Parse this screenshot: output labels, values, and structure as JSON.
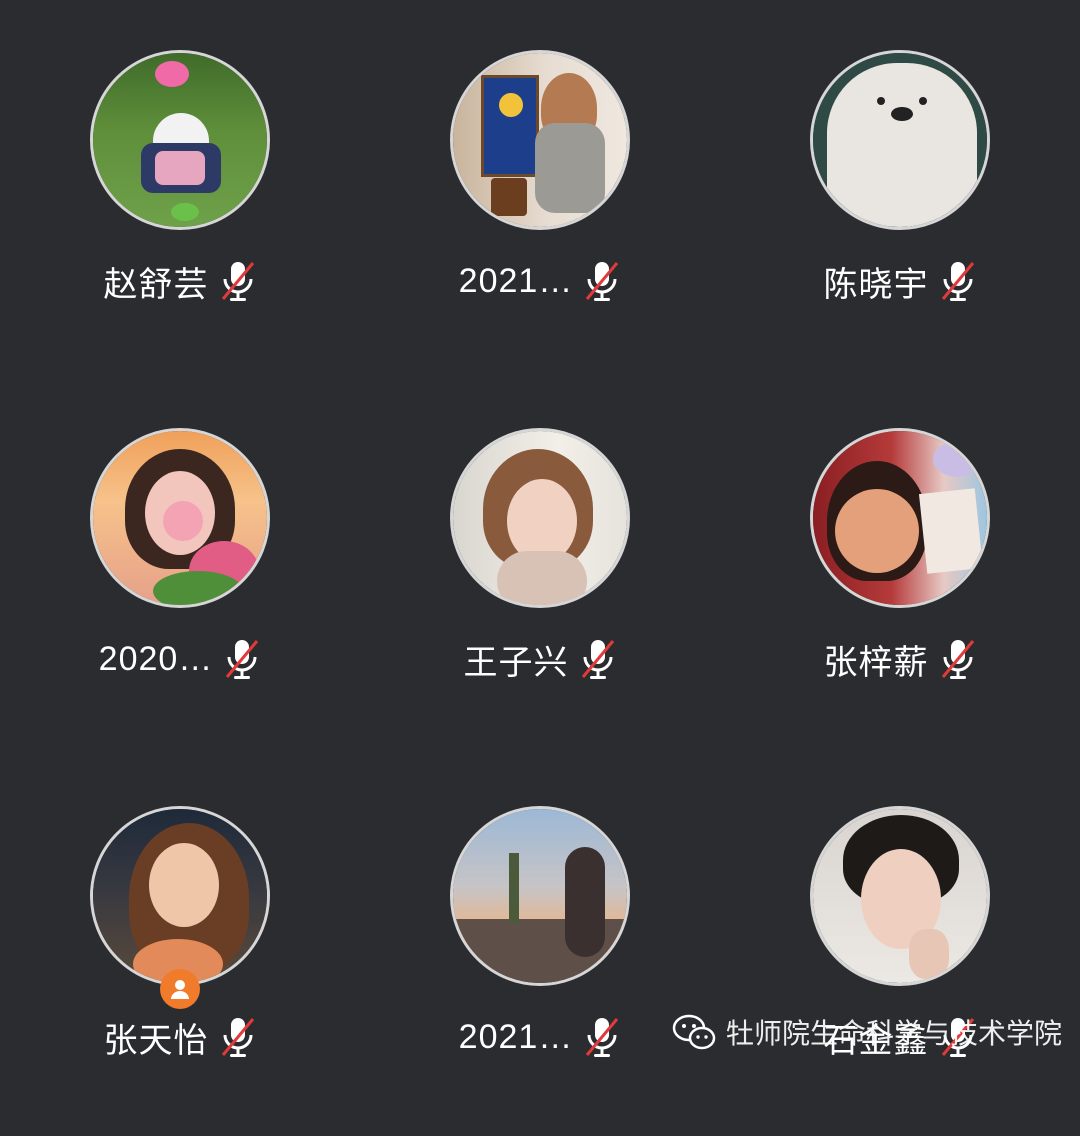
{
  "participants": [
    {
      "name": "赵舒芸",
      "muted": true,
      "icon": "muted-mic-icon"
    },
    {
      "name": "2021…",
      "muted": true,
      "icon": "muted-mic-icon"
    },
    {
      "name": "陈晓宇",
      "muted": true,
      "icon": "muted-mic-icon"
    },
    {
      "name": "2020…",
      "muted": true,
      "icon": "muted-mic-icon"
    },
    {
      "name": "王子兴",
      "muted": true,
      "icon": "muted-mic-icon"
    },
    {
      "name": "张梓薪",
      "muted": true,
      "icon": "muted-mic-icon"
    },
    {
      "name": "张天怡",
      "muted": true,
      "icon": "muted-mic-icon",
      "host": true,
      "badge_icon": "host-person-icon"
    },
    {
      "name": "2021…",
      "muted": true,
      "icon": "muted-mic-icon"
    },
    {
      "name": "石金鑫",
      "muted": true,
      "icon": "muted-mic-icon"
    }
  ],
  "watermark": {
    "icon": "wechat-icon",
    "text": "牡师院生命科学与技术学院"
  },
  "colors": {
    "background": "#2b2c30",
    "avatar_border": "#d6d6d6",
    "muted_slash": "#e03a3a",
    "host_badge": "#f07b2a"
  }
}
